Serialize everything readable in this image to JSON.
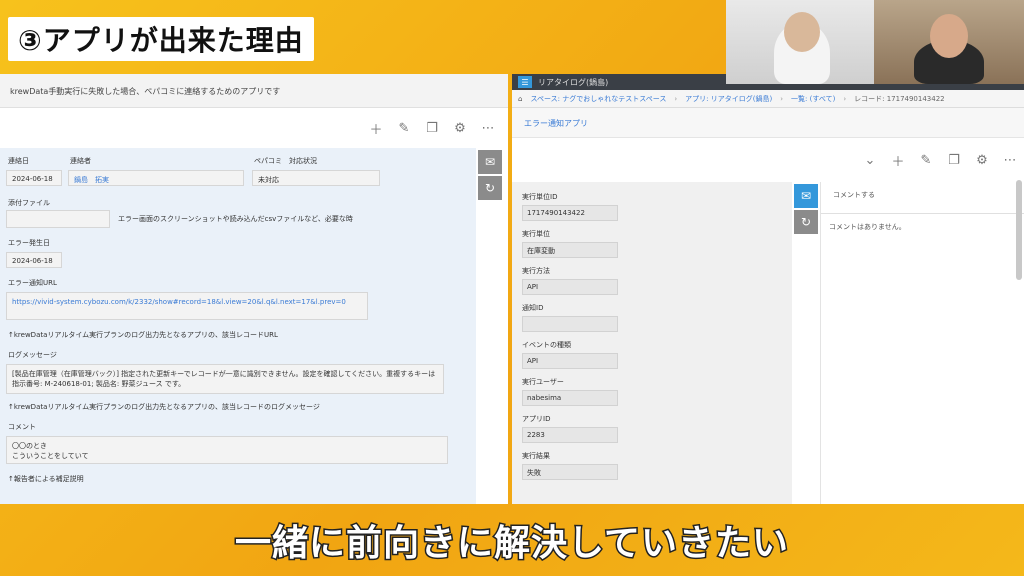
{
  "title": "③アプリが出来た理由",
  "caption": "一緒に前向きに解決していきたい",
  "left": {
    "header": "krewData手動実行に失敗した場合、ペパコミに連絡するためのアプリです",
    "fields": {
      "contact_date_label": "連絡日",
      "contact_date": "2024-06-18",
      "contact_person_label": "連絡者",
      "contact_person": "鍋島　拓実",
      "status_label": "ペパコミ　対応状況",
      "status": "未対応",
      "attachment_label": "添付ファイル",
      "attachment_note": "エラー画面のスクリーンショットや読み込んだcsvファイルなど、必要な時",
      "error_date_label": "エラー発生日",
      "error_date": "2024-06-18",
      "error_url_label": "エラー通知URL",
      "error_url": "https://vivid-system.cybozu.com/k/2332/show#record=18&l.view=20&l.q&l.next=17&l.prev=0",
      "url_note": "↑krewDataリアルタイム実行プランのログ出力先となるアプリの、該当レコードURL",
      "log_label": "ログメッセージ",
      "log_message": "[製品在庫管理（在庫管理バック）] 指定された更新キーでレコードが一意に識別できません。設定を確認してください。重複するキーは 指示番号: M-240618-01; 製品名: 野菜ジュース です。",
      "log_note": "↑krewDataリアルタイム実行プランのログ出力先となるアプリの、該当レコードのログメッセージ",
      "comment_label": "コメント",
      "comment_line1": "〇〇のとき",
      "comment_line2": "こういうことをしていて",
      "reporter_note": "↑報告者による補足説明"
    }
  },
  "right": {
    "app_title": "リアタイログ(鍋島)",
    "breadcrumb": {
      "space": "スペース: ナグでおしゃれなテストスペース",
      "app": "アプリ: リアタイログ(鍋島)",
      "list": "一覧: (すべて)",
      "record": "レコード: 1717490143422"
    },
    "record_title": "エラー通知アプリ",
    "fields": [
      {
        "label": "実行単位ID",
        "value": "1717490143422"
      },
      {
        "label": "実行単位",
        "value": "在庫変動"
      },
      {
        "label": "実行方法",
        "value": "API"
      },
      {
        "label": "通知ID",
        "value": ""
      },
      {
        "label": "イベントの種類",
        "value": "API"
      },
      {
        "label": "実行ユーザー",
        "value": "nabesima"
      },
      {
        "label": "アプリID",
        "value": "2283"
      },
      {
        "label": "実行結果",
        "value": "失敗"
      }
    ],
    "comment_placeholder": "コメントする",
    "comment_empty": "コメントはありません。"
  },
  "icons": {
    "add": "plus-icon",
    "edit": "pencil-icon",
    "copy": "copy-icon",
    "settings": "gear-icon",
    "more": "more-icon",
    "comment": "comment-icon",
    "history": "history-icon",
    "chevron": "chevron-down-icon"
  }
}
